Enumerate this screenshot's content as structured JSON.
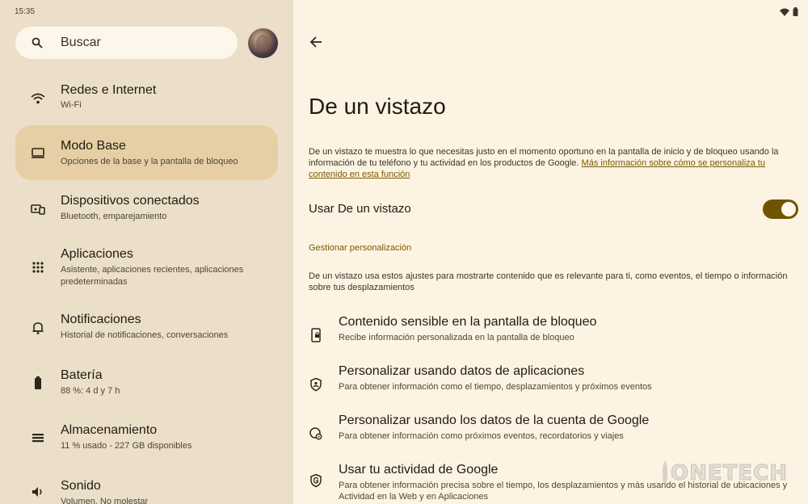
{
  "status": {
    "time": "15:35"
  },
  "left": {
    "search_label": "Buscar",
    "items": [
      {
        "title": "Redes e Internet",
        "sub": "Wi-Fi",
        "icon": "wifi-icon"
      },
      {
        "title": "Modo Base",
        "sub": "Opciones de la base y la pantalla de bloqueo",
        "icon": "dock-icon",
        "selected": true
      },
      {
        "title": "Dispositivos conectados",
        "sub": "Bluetooth, emparejamiento",
        "icon": "devices-icon"
      },
      {
        "title": "Aplicaciones",
        "sub": "Asistente, aplicaciones recientes, aplicaciones predeterminadas",
        "icon": "apps-grid-icon"
      },
      {
        "title": "Notificaciones",
        "sub": "Historial de notificaciones, conversaciones",
        "icon": "bell-icon"
      },
      {
        "title": "Batería",
        "sub": "88 %: 4 d y 7 h",
        "icon": "battery-icon"
      },
      {
        "title": "Almacenamiento",
        "sub": "11 % usado - 227 GB disponibles",
        "icon": "storage-icon"
      },
      {
        "title": "Sonido",
        "sub": "Volumen, No molestar",
        "icon": "volume-icon"
      }
    ]
  },
  "right": {
    "title": "De un vistazo",
    "desc_text": "De un vistazo te muestra lo que necesitas justo en el momento oportuno en la pantalla de inicio y de bloqueo usando la información de tu teléfono y tu actividad en los productos de Google. ",
    "desc_link": "Más información sobre cómo se personaliza tu contenido en esta función",
    "switch_label": "Usar De un vistazo",
    "switch_on": true,
    "section_head": "Gestionar personalización",
    "section_desc": "De un vistazo usa estos ajustes para mostrarte contenido que es relevante para ti, como eventos, el tiempo o información sobre tus desplazamientos",
    "options": [
      {
        "title": "Contenido sensible en la pantalla de bloqueo",
        "sub": "Recibe información personalizada en la pantalla de bloqueo",
        "icon": "phone-lock-icon"
      },
      {
        "title": "Personalizar usando datos de aplicaciones",
        "sub": "Para obtener información como el tiempo, desplazamientos y próximos eventos",
        "icon": "shield-person-icon"
      },
      {
        "title": "Personalizar usando los datos de la cuenta de Google",
        "sub": "Para obtener información como próximos eventos, recordatorios y viajes",
        "icon": "account-gear-icon"
      },
      {
        "title": "Usar tu actividad de Google",
        "sub": "Para obtener información precisa sobre el tiempo, los desplazamientos y más usando el historial de ubicaciones y Actividad en la Web y en Aplicaciones",
        "icon": "google-shield-icon"
      }
    ]
  },
  "watermark": "ONETECH",
  "colors": {
    "accent": "#6d5400",
    "selected_bg": "#e6cfa5",
    "left_bg": "#ebdfc9",
    "right_bg": "#fdf3e2"
  }
}
